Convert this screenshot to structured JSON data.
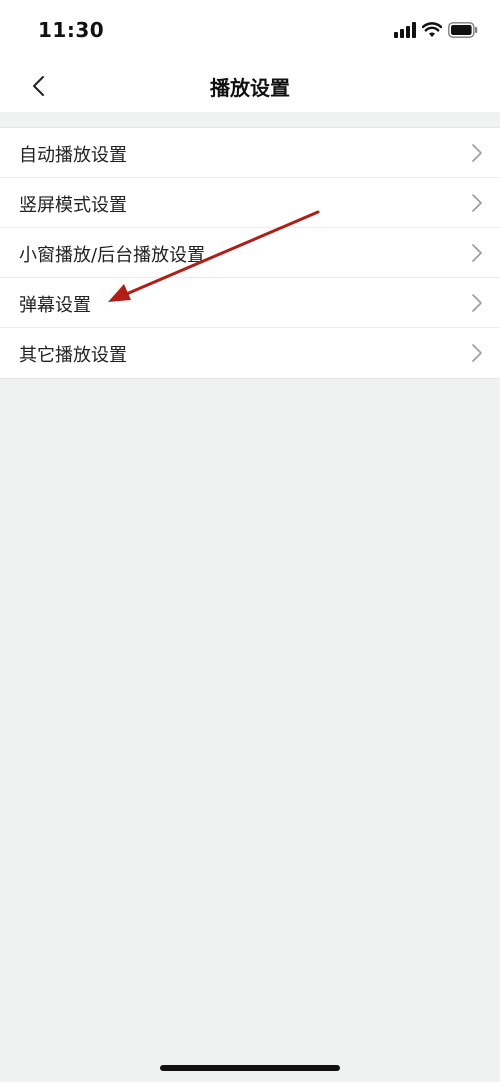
{
  "status_bar": {
    "time": "11:30"
  },
  "nav": {
    "title": "播放设置"
  },
  "settings_items": [
    {
      "label": "自动播放设置"
    },
    {
      "label": "竖屏模式设置"
    },
    {
      "label": "小窗播放/后台播放设置"
    },
    {
      "label": "弹幕设置"
    },
    {
      "label": "其它播放设置"
    }
  ],
  "annotation": {
    "color": "#b01e17"
  },
  "colors": {
    "background": "#f0f1f1",
    "surface": "#ffffff",
    "chevron": "#9a9a9a"
  }
}
